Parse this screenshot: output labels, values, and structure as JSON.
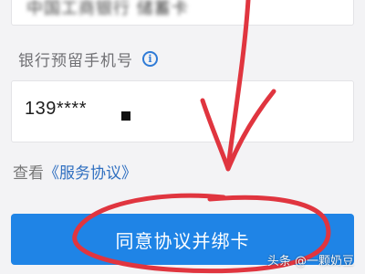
{
  "top_field": {
    "value": "中国工商银行 储蓄卡"
  },
  "phone_section": {
    "label": "银行预留手机号",
    "info_icon": "info-icon",
    "value": "139****"
  },
  "agreement": {
    "prefix": "查看",
    "link": "《服务协议》"
  },
  "confirm_button": {
    "label": "同意协议并绑卡"
  },
  "annotation": {
    "color": "#e0353f",
    "shapes": [
      "arrow",
      "circle"
    ]
  },
  "watermark": {
    "text": "头条 @一颗奶豆"
  },
  "colors": {
    "accent": "#1f84e6",
    "link": "#2f6fc0",
    "background": "#f3f3f5"
  }
}
